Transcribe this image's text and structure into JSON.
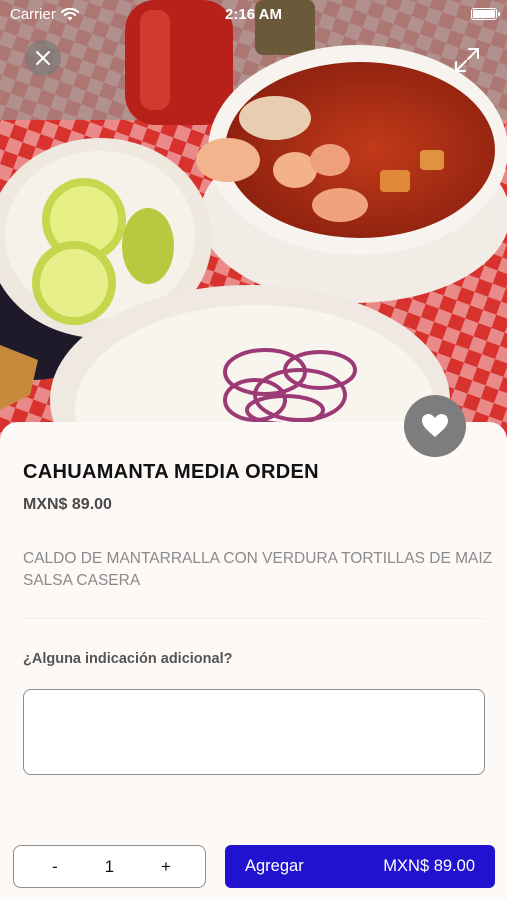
{
  "status_bar": {
    "carrier": "Carrier",
    "time": "2:16 AM"
  },
  "product": {
    "title": "CAHUAMANTA MEDIA ORDEN",
    "price": "MXN$ 89.00",
    "description": "CALDO DE MANTARRALLA CON VERDURA TORTILLAS DE MAIZ SALSA CASERA"
  },
  "notes": {
    "label": "¿Alguna indicación adicional?",
    "placeholder": "",
    "value": ""
  },
  "quantity": {
    "minus": "-",
    "value": "1",
    "plus": "+"
  },
  "add_button": {
    "label": "Agregar",
    "total": "MXN$ 89.00"
  },
  "colors": {
    "accent": "#2112cf",
    "fav_bg": "#7d7d7d"
  },
  "icons": [
    "wifi-icon",
    "battery-icon",
    "close-icon",
    "expand-icon",
    "heart-icon"
  ]
}
